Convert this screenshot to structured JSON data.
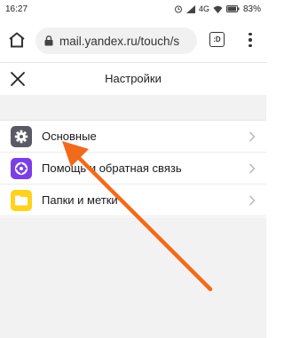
{
  "status_bar": {
    "time": "16:27",
    "network": "4G",
    "battery": "83%"
  },
  "browser": {
    "url": "mail.yandex.ru/touch/s",
    "tab_count": ":D",
    "icons": {
      "home": "home-icon",
      "lock": "lock-icon",
      "tabs": "tab-switcher-icon",
      "menu": "more-vert-icon"
    }
  },
  "header": {
    "title": "Настройки",
    "close_icon": "close-icon"
  },
  "settings": {
    "items": [
      {
        "label": "Основные",
        "icon": "gear-icon",
        "icon_color": "#5a5a66"
      },
      {
        "label": "Помощь и обратная связь",
        "icon": "help-lifebuoy-icon",
        "icon_color": "#7b3fe4"
      },
      {
        "label": "Папки и метки",
        "icon": "folder-icon",
        "icon_color": "#ffd21f"
      }
    ]
  },
  "colors": {
    "annotation_arrow": "#f26a1b",
    "background_gray": "#f2f2f2"
  }
}
